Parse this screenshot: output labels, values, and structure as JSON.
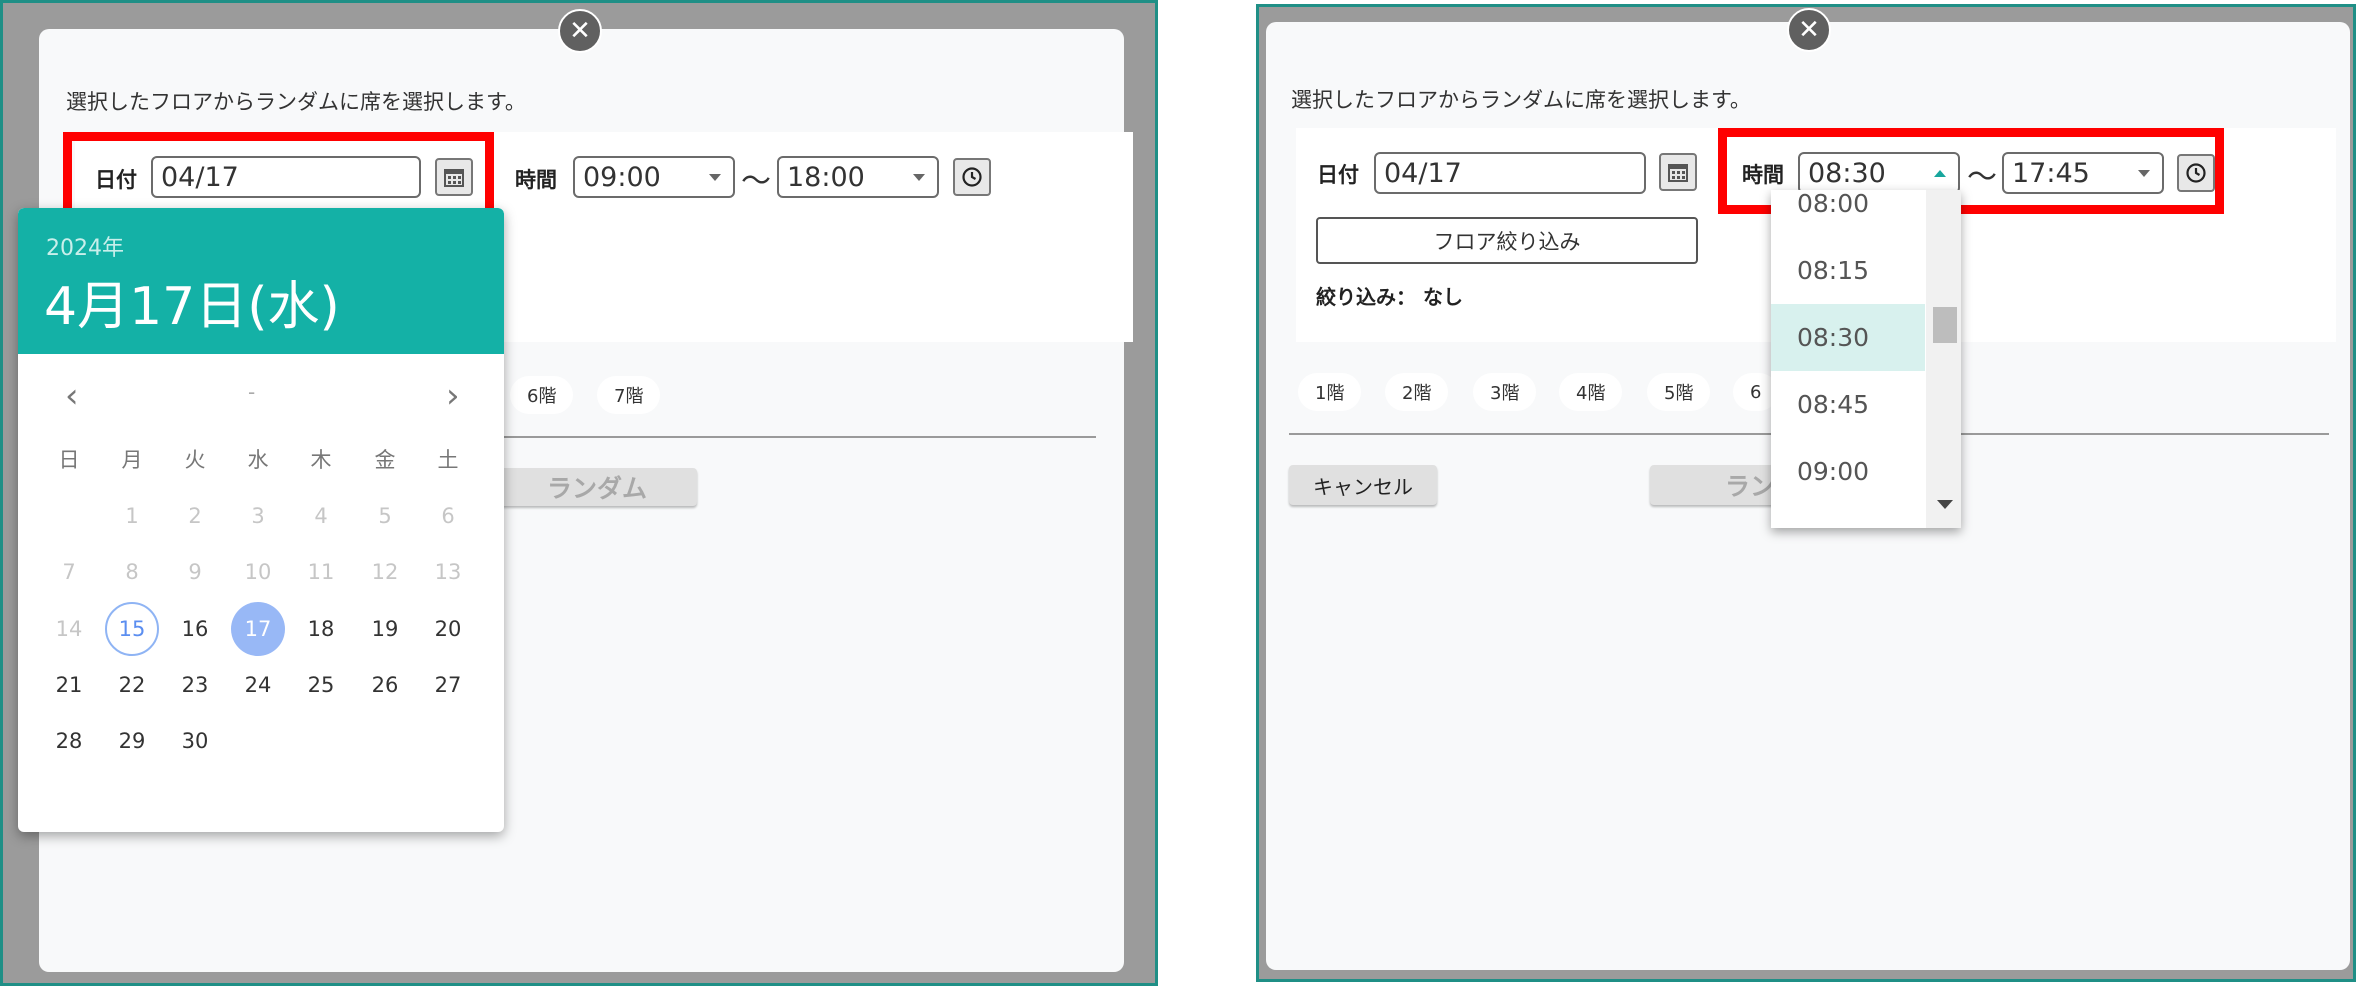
{
  "left": {
    "close_symbol": "✕",
    "intro": "選択したフロアからランダムに席を選択します。",
    "date_label": "日付",
    "date_value": "04/17",
    "time_label": "時間",
    "time_start": "09:00",
    "time_end": "18:00",
    "tilde": "〜",
    "floor_chips": [
      "6階",
      "7階"
    ],
    "random_button": "ランダム",
    "datepicker": {
      "year": "2024年",
      "date_big": "4月17日(水)",
      "month_label": "-",
      "prev": "‹",
      "next": "›",
      "weekdays": [
        "日",
        "月",
        "火",
        "水",
        "木",
        "金",
        "土"
      ],
      "weeks": [
        [
          "",
          "1",
          "2",
          "3",
          "4",
          "5",
          "6"
        ],
        [
          "7",
          "8",
          "9",
          "10",
          "11",
          "12",
          "13"
        ],
        [
          "14",
          "15",
          "16",
          "17",
          "18",
          "19",
          "20"
        ],
        [
          "21",
          "22",
          "23",
          "24",
          "25",
          "26",
          "27"
        ],
        [
          "28",
          "29",
          "30",
          "",
          "",
          "",
          ""
        ]
      ],
      "today": "15",
      "selected": "17"
    }
  },
  "right": {
    "close_symbol": "✕",
    "intro": "選択したフロアからランダムに席を選択します。",
    "date_label": "日付",
    "date_value": "04/17",
    "time_label": "時間",
    "time_start": "08:30",
    "time_end": "17:45",
    "tilde": "〜",
    "floor_filter_button": "フロア絞り込み",
    "filter_status_label": "絞り込み：",
    "filter_status_value": "なし",
    "floor_chips": [
      "1階",
      "2階",
      "3階",
      "4階",
      "5階",
      "6"
    ],
    "cancel_button": "キャンセル",
    "random_button": "ラン",
    "time_options": [
      "08:00",
      "08:15",
      "08:30",
      "08:45",
      "09:00"
    ],
    "time_selected": "08:30"
  },
  "icons": {
    "calendar": "calendar-icon",
    "clock": "clock-icon",
    "close": "close-icon"
  },
  "colors": {
    "teal": "#14b1a6",
    "highlight": "#ff0000",
    "selected_day": "#98b8f6"
  }
}
